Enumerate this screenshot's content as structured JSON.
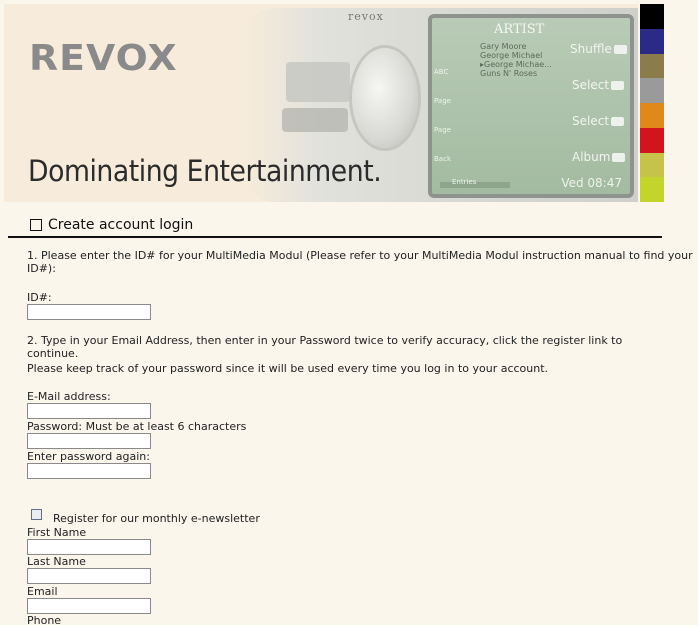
{
  "header": {
    "logo_text": "REVOX",
    "tagline": "Dominating Entertainment.",
    "device": {
      "brand": "revox",
      "screen_title": "ARTIST",
      "list_items": [
        "Gary Moore",
        "George Michael",
        "▸George Michae...",
        "Guns N' Roses"
      ],
      "left_tags": [
        "ABC",
        "Page",
        "Page",
        "Back"
      ],
      "side_labels": [
        "Shuffle",
        "Select",
        "Select",
        "Album"
      ],
      "footer_left": "Entries",
      "footer_right": "Ved 08:47"
    },
    "stripe_colors": [
      "#000000",
      "#2b2a86",
      "#8c7c4b",
      "#9a9a9a",
      "#e0891b",
      "#d4141c",
      "#c6c24a",
      "#c3d52a"
    ]
  },
  "section": {
    "heading": "Create account login"
  },
  "form": {
    "step1": "1. Please enter the ID# for your MultiMedia Modul (Please refer to your MultiMedia Modul instruction manual to find your ID#):",
    "id_label": "ID#:",
    "step2": "2. Type in your Email Address, then enter in your Password twice to verify accuracy, click the register link to continue.",
    "step2_note": "Please keep track of your password since it will be used every time you log in to your account.",
    "email_label": "E-Mail address:",
    "password_label": "Password: Must be at least 6 characters",
    "password_again_label": "Enter password again:",
    "newsletter_label": "Register for our monthly e-newsletter",
    "first_name_label": "First Name",
    "last_name_label": "Last Name",
    "news_email_label": "Email",
    "phone_label": "Phone",
    "id_value": "",
    "email_value": "",
    "password_value": "",
    "password_again_value": "",
    "first_name_value": "",
    "last_name_value": "",
    "news_email_value": ""
  }
}
